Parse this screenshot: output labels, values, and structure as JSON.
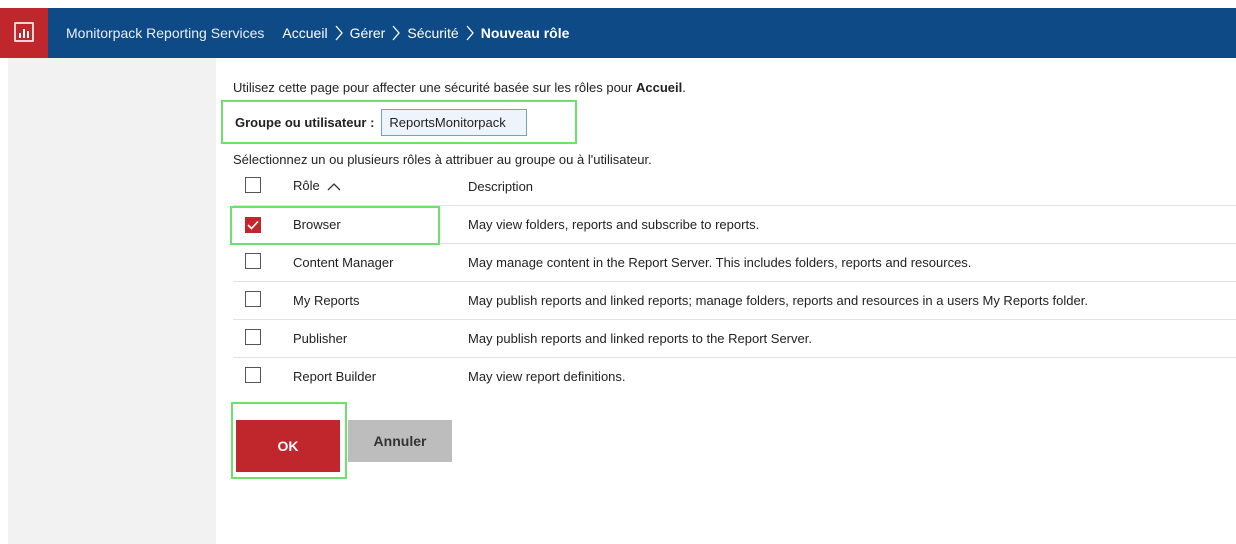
{
  "header": {
    "brand": "Monitorpack Reporting Services",
    "breadcrumb": [
      {
        "label": "Accueil"
      },
      {
        "label": "Gérer"
      },
      {
        "label": "Sécurité"
      },
      {
        "label": "Nouveau rôle"
      }
    ],
    "accent": "#c0272d",
    "bar_color": "#0e4a86"
  },
  "intro": {
    "text": "Utilisez cette page pour affecter une sécurité basée sur les rôles pour ",
    "item": "Accueil",
    "end": "."
  },
  "group": {
    "label": "Groupe ou utilisateur :",
    "value": "ReportsMonitorpack"
  },
  "select_text": "Sélectionnez un ou plusieurs rôles à attribuer au groupe ou à l'utilisateur.",
  "table": {
    "headers": {
      "role": "Rôle",
      "description": "Description"
    },
    "rows": [
      {
        "role": "Browser",
        "description": "May view folders, reports and subscribe to reports.",
        "checked": true
      },
      {
        "role": "Content Manager",
        "description": "May manage content in the Report Server. This includes folders, reports and resources.",
        "checked": false
      },
      {
        "role": "My Reports",
        "description": "May publish reports and linked reports; manage folders, reports and resources in a users My Reports folder.",
        "checked": false
      },
      {
        "role": "Publisher",
        "description": "May publish reports and linked reports to the Report Server.",
        "checked": false
      },
      {
        "role": "Report Builder",
        "description": "May view report definitions.",
        "checked": false
      }
    ]
  },
  "buttons": {
    "ok": "OK",
    "cancel": "Annuler"
  },
  "icons": {
    "logo": "report-chart-icon",
    "breadcrumb_separator": "chevron-right-icon",
    "sort": "chevron-up-icon",
    "checkbox_checked": "checkmark-icon"
  }
}
